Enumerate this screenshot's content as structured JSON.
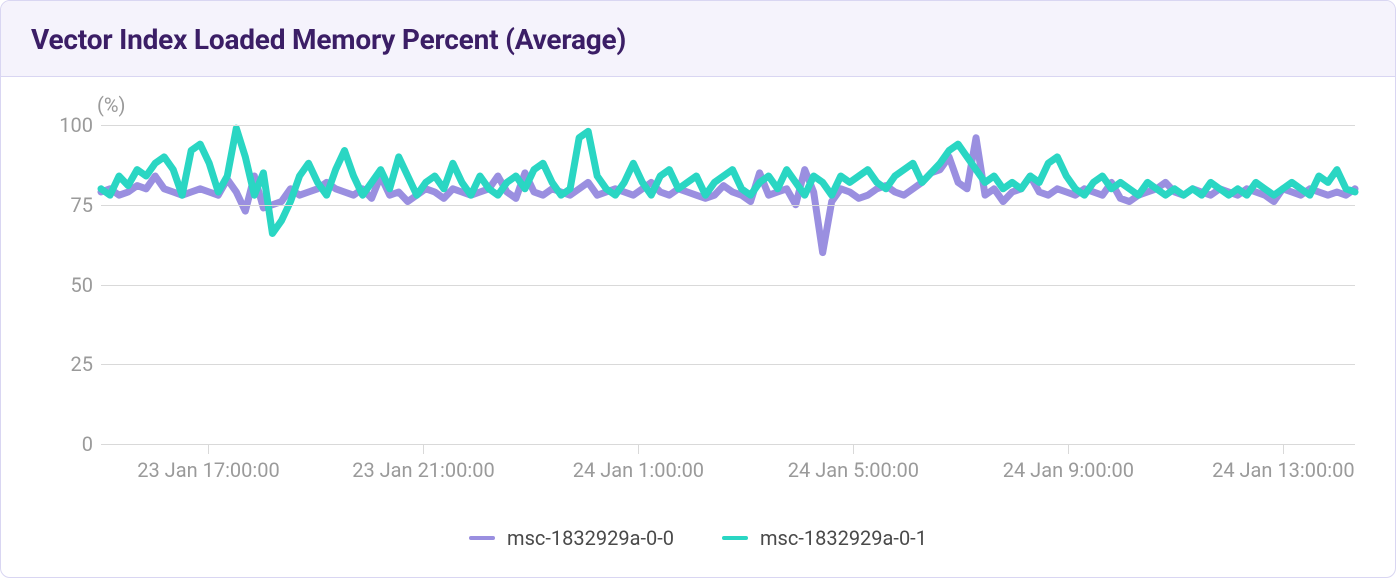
{
  "title": "Vector Index Loaded Memory Percent (Average)",
  "chart_data": {
    "type": "line",
    "ylabel": "(%)",
    "xlabel": "",
    "ylim": [
      0,
      100
    ],
    "y_ticks": [
      0,
      25,
      50,
      75,
      100
    ],
    "x_ticks": [
      "23 Jan 17:00:00",
      "23 Jan 21:00:00",
      "24 Jan 1:00:00",
      "24 Jan 5:00:00",
      "24 Jan 9:00:00",
      "24 Jan 13:00:00"
    ],
    "x_range": [
      0,
      140
    ],
    "x_tick_positions": [
      12,
      36,
      60,
      84,
      108,
      132
    ],
    "colors": {
      "msc-1832929a-0-0": "#9a8fe0",
      "msc-1832929a-0-1": "#2ad6c3"
    },
    "series": [
      {
        "name": "msc-1832929a-0-0",
        "values": [
          79,
          80,
          78,
          79,
          81,
          80,
          84,
          80,
          79,
          78,
          79,
          80,
          79,
          78,
          83,
          79,
          73,
          84,
          74,
          75,
          76,
          80,
          78,
          79,
          80,
          82,
          80,
          79,
          78,
          80,
          77,
          84,
          78,
          79,
          76,
          78,
          80,
          79,
          77,
          80,
          79,
          78,
          79,
          80,
          84,
          79,
          77,
          85,
          79,
          78,
          80,
          79,
          78,
          80,
          82,
          78,
          79,
          80,
          79,
          78,
          80,
          82,
          79,
          78,
          80,
          79,
          78,
          77,
          78,
          81,
          79,
          78,
          76,
          85,
          78,
          79,
          80,
          75,
          86,
          79,
          60,
          76,
          80,
          79,
          77,
          78,
          80,
          81,
          79,
          78,
          80,
          82,
          85,
          86,
          90,
          82,
          80,
          96,
          78,
          80,
          76,
          79,
          80,
          84,
          79,
          78,
          80,
          79,
          78,
          80,
          79,
          78,
          82,
          77,
          76,
          78,
          79,
          80,
          82,
          79,
          78,
          80,
          79,
          78,
          80,
          79,
          78,
          80,
          79,
          78,
          76,
          80,
          79,
          78,
          80,
          79,
          78,
          79,
          78,
          80
        ]
      },
      {
        "name": "msc-1832929a-0-1",
        "values": [
          80,
          78,
          84,
          81,
          86,
          84,
          88,
          90,
          86,
          78,
          92,
          94,
          88,
          79,
          84,
          99,
          90,
          78,
          85,
          66,
          70,
          76,
          84,
          88,
          82,
          78,
          86,
          92,
          84,
          78,
          82,
          86,
          80,
          90,
          84,
          78,
          82,
          84,
          80,
          88,
          82,
          78,
          84,
          80,
          78,
          82,
          84,
          80,
          86,
          88,
          82,
          78,
          80,
          96,
          98,
          84,
          80,
          78,
          82,
          88,
          82,
          78,
          84,
          86,
          80,
          82,
          84,
          78,
          82,
          84,
          86,
          80,
          78,
          82,
          84,
          80,
          86,
          82,
          78,
          84,
          82,
          78,
          84,
          82,
          84,
          86,
          82,
          80,
          84,
          86,
          88,
          82,
          85,
          88,
          92,
          94,
          90,
          86,
          82,
          84,
          80,
          82,
          80,
          84,
          82,
          88,
          90,
          84,
          80,
          78,
          82,
          84,
          80,
          82,
          80,
          78,
          82,
          80,
          78,
          80,
          78,
          80,
          78,
          82,
          80,
          78,
          80,
          78,
          82,
          80,
          78,
          80,
          82,
          80,
          78,
          84,
          82,
          86,
          80,
          79
        ]
      }
    ],
    "legend": [
      "msc-1832929a-0-0",
      "msc-1832929a-0-1"
    ]
  }
}
